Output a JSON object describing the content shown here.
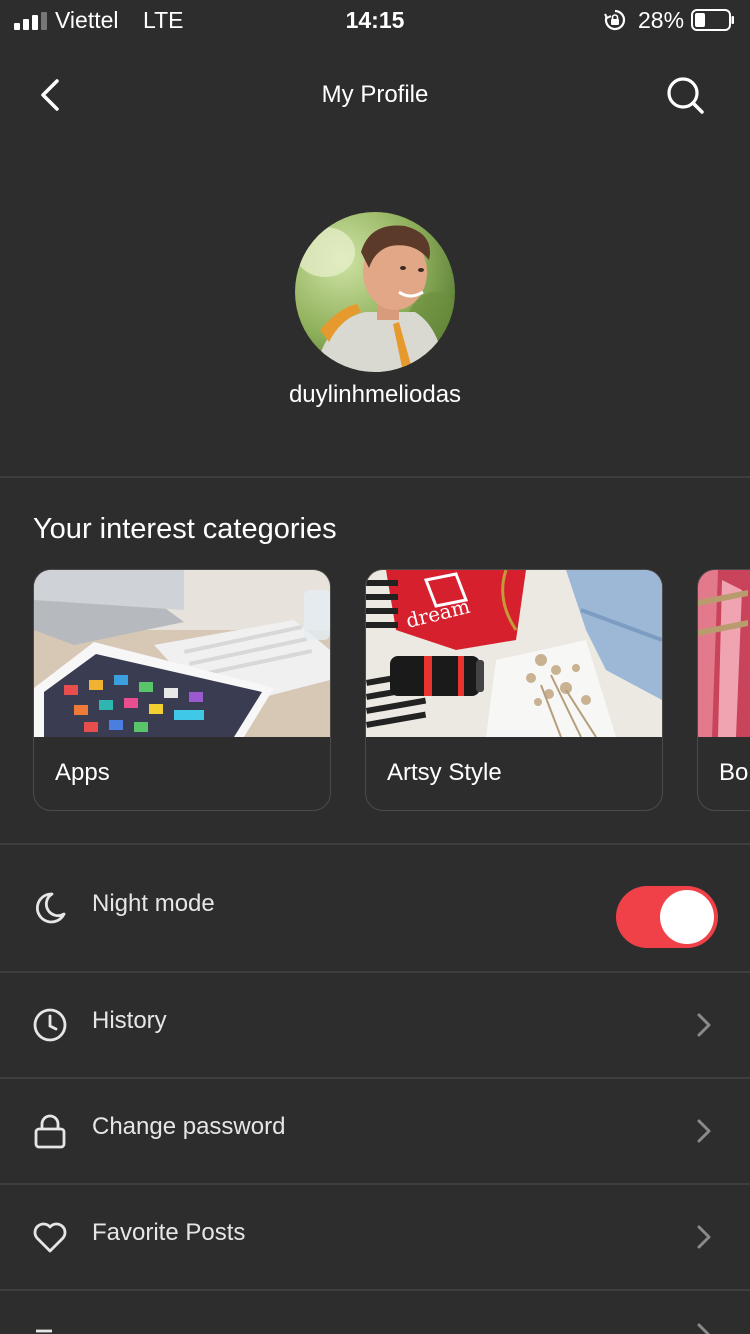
{
  "status_bar": {
    "carrier": "Viettel",
    "network": "LTE",
    "time": "14:15",
    "battery": "28%"
  },
  "nav": {
    "title": "My Profile",
    "back_icon": "chevron-left-icon",
    "search_icon": "search-icon"
  },
  "profile": {
    "username": "duylinhmeliodas"
  },
  "interests": {
    "title": "Your interest categories",
    "cards": [
      {
        "label": "Apps"
      },
      {
        "label": "Artsy Style"
      },
      {
        "label": "Bo"
      }
    ]
  },
  "settings": {
    "night_mode": {
      "label": "Night mode",
      "icon": "moon-icon",
      "enabled": true
    },
    "items": [
      {
        "label": "History",
        "icon": "clock-icon"
      },
      {
        "label": "Change password",
        "icon": "lock-icon"
      },
      {
        "label": "Favorite Posts",
        "icon": "heart-icon"
      }
    ]
  },
  "colors": {
    "background": "#2d2d2d",
    "accent": "#f04148",
    "divider": "#3e3e3e"
  }
}
